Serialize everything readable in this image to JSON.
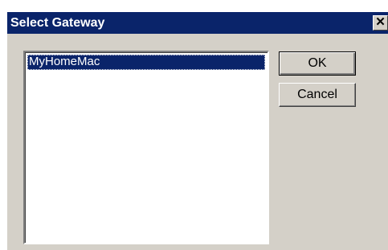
{
  "window": {
    "title": "Select Gateway",
    "close_label": "✕"
  },
  "gateway_list": {
    "items": [
      "MyHomeMac"
    ],
    "selected_index": 0
  },
  "buttons": {
    "ok_label": "OK",
    "cancel_label": "Cancel"
  }
}
